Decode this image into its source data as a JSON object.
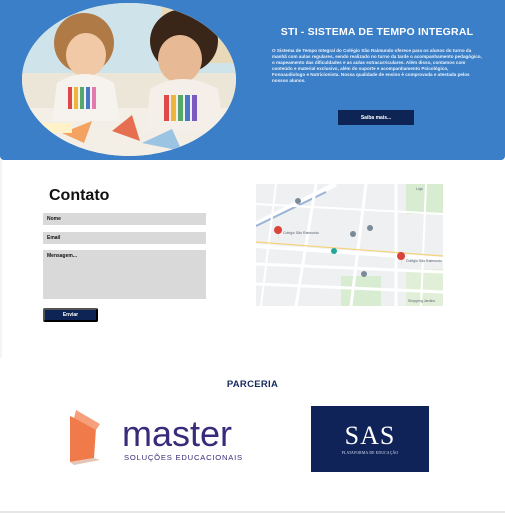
{
  "hero": {
    "title": "STI - SISTEMA DE TEMPO INTEGRAL",
    "description": "O Sistema de Tempo Integral do Colégio São Raimundo oferece para os alunos do turno da manhã com aulas regulares, sendo realizado no turno da tarde o acompanhamento pedagógico, o mapeamento das dificuldades e as aulas extracurriculares. Além disso, contamos com conteúdo e material exclusivo, além do suporte e acompanhamento Psicológico, Fonoaudiologo e Nutricionista. Nossa qualidade de ensino é comprovada e atestada pelos nossos alunos.",
    "button_label": "Saiba mais..."
  },
  "contact": {
    "title": "Contato",
    "name_placeholder": "Nome",
    "email_placeholder": "Email",
    "message_placeholder": "Mensagem...",
    "send_label": "Enviar"
  },
  "map": {
    "labels": [
      "Colégio São Raimundo",
      "Colégio São Raimundo",
      "Loja Suaves",
      "Shopping Jardins"
    ]
  },
  "partners": {
    "title": "PARCERIA",
    "master": {
      "name": "master",
      "tagline": "SOLUÇÕES EDUCACIONAIS",
      "colors": {
        "orange": "#f07a4a",
        "purple": "#3a2a7a"
      }
    },
    "sas": {
      "name": "SAS",
      "tagline": "PLATAFORMA DE EDUCAÇÃO",
      "bg": "#0f2359"
    }
  },
  "colors": {
    "hero_bg": "#3b7fc8",
    "button_bg": "#0e2454",
    "field_bg": "#d9d9d9"
  }
}
